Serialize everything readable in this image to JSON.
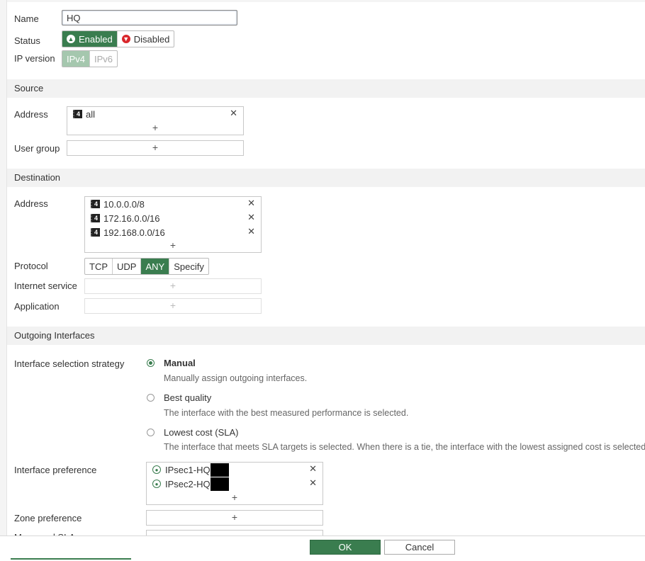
{
  "name": {
    "label": "Name",
    "value": "HQ"
  },
  "status": {
    "label": "Status",
    "enabled": "Enabled",
    "disabled": "Disabled"
  },
  "ip_version": {
    "label": "IP version",
    "ipv4": "IPv4",
    "ipv6": "IPv6"
  },
  "source": {
    "section": "Source",
    "address_label": "Address",
    "addresses": [
      "all"
    ],
    "user_group_label": "User group"
  },
  "destination": {
    "section": "Destination",
    "address_label": "Address",
    "addresses": [
      "10.0.0.0/8",
      "172.16.0.0/16",
      "192.168.0.0/16"
    ],
    "protocol_label": "Protocol",
    "protocols": [
      "TCP",
      "UDP",
      "ANY",
      "Specify"
    ],
    "selected_protocol": "ANY",
    "internet_service_label": "Internet service",
    "application_label": "Application"
  },
  "outgoing": {
    "section": "Outgoing Interfaces",
    "strategy_label": "Interface selection strategy",
    "options": [
      {
        "title": "Manual",
        "desc": "Manually assign outgoing interfaces."
      },
      {
        "title": "Best quality",
        "desc": "The interface with the best measured performance is selected."
      },
      {
        "title": "Lowest cost (SLA)",
        "desc": "The interface that meets SLA targets is selected. When there is a tie, the interface with the lowest assigned cost is selected."
      }
    ],
    "selected_option": "Manual",
    "interface_pref_label": "Interface preference",
    "interfaces": [
      "IPsec1-HQ",
      "IPsec2-HQ"
    ],
    "zone_pref_label": "Zone preference",
    "measured_sla_label": "Measured SLA"
  },
  "footer": {
    "ok": "OK",
    "cancel": "Cancel"
  },
  "icons": {
    "add": "+",
    "remove": "✕",
    "address": "4"
  },
  "colors": {
    "accent": "#3a7d4f",
    "danger": "#d9262b",
    "section_bg": "#f2f2f2"
  }
}
